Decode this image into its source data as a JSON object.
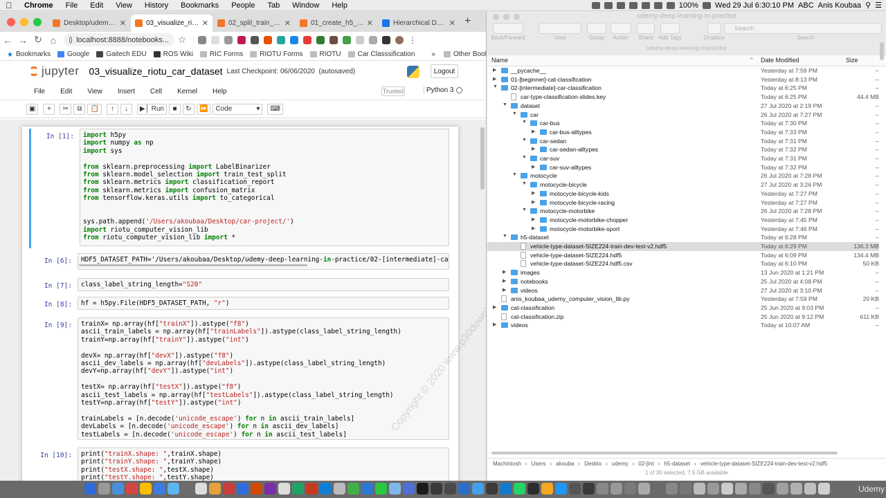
{
  "menubar": {
    "items": [
      "Chrome",
      "File",
      "Edit",
      "View",
      "History",
      "Bookmarks",
      "People",
      "Tab",
      "Window",
      "Help"
    ],
    "battery": "100%",
    "clock": "Wed 29 Jul  6:30:10 PM",
    "input_method": "ABC",
    "user": "Anis Koubaa"
  },
  "chrome": {
    "tabs": [
      {
        "label": "Desktop/udemy-de"
      },
      {
        "label": "03_visualize_riotu_c"
      },
      {
        "label": "02_split_train_dev_t"
      },
      {
        "label": "01_create_h5_datas"
      },
      {
        "label": "Hierarchical Data Fo"
      }
    ],
    "url": "localhost:8888/notebooks...",
    "bookmarks": [
      "Bookmarks",
      "Google",
      "Gaitech EDU",
      "ROS Wiki",
      "RIC Forms",
      "RIOTU Forms",
      "RIOTU",
      "Car Classsification",
      "Other Bookmarks"
    ]
  },
  "jupyter": {
    "logo": "jupyter",
    "title": "03_visualize_riotu_car_dataset",
    "checkpoint": "Last Checkpoint: 06/06/2020",
    "autosaved": "(autosaved)",
    "logout": "Logout",
    "menu": [
      "File",
      "Edit",
      "View",
      "Insert",
      "Cell",
      "Kernel",
      "Help"
    ],
    "trusted": "Trusted",
    "kernel": "Python 3",
    "toolbar": {
      "run": "Run",
      "celltype": "Code"
    },
    "cells": [
      {
        "prompt": "In [1]:",
        "code": "import h5py\nimport numpy as np\nimport sys\n\nfrom sklearn.preprocessing import LabelBinarizer\nfrom sklearn.model_selection import train_test_split\nfrom sklearn.metrics import classification_report\nfrom sklearn.metrics import confusion_matrix\nfrom tensorflow.keras.utils import to_categorical\n\n\nsys.path.append('/Users/akoubaa/Desktop/car-project/')\nimport riotu_computer_vision_lib\nfrom riotu_computer_vision_lib import *"
      },
      {
        "prompt": "In [6]:",
        "code": "HDF5_DATASET_PATH='/Users/akoubaa/Desktop/udemy-deep-learning-in-practice/02-[intermediate]-car"
      },
      {
        "prompt": "In [7]:",
        "code": "class_label_string_length=\"S20\""
      },
      {
        "prompt": "In [8]:",
        "code": "hf = h5py.File(HDF5_DATASET_PATH, \"r\")"
      },
      {
        "prompt": "In [9]:",
        "code": "trainX= np.array(hf[\"trainX\"]).astype(\"f8\")\nascii_train_labels = np.array(hf[\"trainLabels\"]).astype(class_label_string_length)\ntrainY=np.array(hf[\"trainY\"]).astype(\"int\")\n\ndevX= np.array(hf[\"devX\"]).astype(\"f8\")\nascii_dev_labels = np.array(hf[\"devLabels\"]).astype(class_label_string_length)\ndevY=np.array(hf[\"devY\"]).astype(\"int\")\n\ntestX= np.array(hf[\"testX\"]).astype(\"f8\")\nascii_test_labels = np.array(hf[\"testLabels\"]).astype(class_label_string_length)\ntestY=np.array(hf[\"testY\"]).astype(\"int\")\n\ntrainLabels = [n.decode('unicode_escape') for n in ascii_train_labels]\ndevLabels = [n.decode('unicode_escape') for n in ascii_dev_labels]\ntestLabels = [n.decode('unicode_escape') for n in ascii_test_labels]"
      },
      {
        "prompt": "In [10]:",
        "code": "print(\"trainX.shape: \",trainX.shape)\nprint(\"trainY.shape: \",trainY.shape)\nprint(\"testX.shape: \",testX.shape)\nprint(\"testY.shape: \",testY.shape)"
      }
    ]
  },
  "finder": {
    "window_title": "udemy-deep-learning-in-practice",
    "toolbar_labels": [
      "Back/Forward",
      "View",
      "Group",
      "Action",
      "Share",
      "Add Tags",
      "Dropbox"
    ],
    "search_placeholder": "Search",
    "search_label": "Search",
    "path_title": "udemy-deep-learning-in-practice",
    "columns": {
      "name": "Name",
      "date": "Date Modified",
      "size": "Size"
    },
    "rows": [
      {
        "indent": 0,
        "type": "folder",
        "open": false,
        "name": "__pycache__",
        "date": "Yesterday at 7:59 PM",
        "size": "--"
      },
      {
        "indent": 0,
        "type": "folder",
        "open": false,
        "name": "01-[beginner]-cat-classification",
        "date": "Yesterday at 8:13 PM",
        "size": "--"
      },
      {
        "indent": 0,
        "type": "folder",
        "open": true,
        "name": "02-[intermediate]-car-classification",
        "date": "Today at 6:25 PM",
        "size": "--"
      },
      {
        "indent": 1,
        "type": "file",
        "open": null,
        "name": "car-type-classification-slides.key",
        "date": "Today at 6:25 PM",
        "size": "44.4 MB"
      },
      {
        "indent": 1,
        "type": "folder",
        "open": true,
        "name": "dataset",
        "date": "27 Jul 2020 at 2:19 PM",
        "size": "--"
      },
      {
        "indent": 2,
        "type": "folder",
        "open": true,
        "name": "car",
        "date": "26 Jul 2020 at 7:27 PM",
        "size": "--"
      },
      {
        "indent": 3,
        "type": "folder",
        "open": true,
        "name": "car-bus",
        "date": "Today at 7:30 PM",
        "size": "--"
      },
      {
        "indent": 4,
        "type": "folder",
        "open": false,
        "name": "car-bus-alltypes",
        "date": "Today at 7:33 PM",
        "size": "--"
      },
      {
        "indent": 3,
        "type": "folder",
        "open": true,
        "name": "car-sedan",
        "date": "Today at 7:31 PM",
        "size": "--"
      },
      {
        "indent": 4,
        "type": "folder",
        "open": false,
        "name": "car-sedan-alltypes",
        "date": "Today at 7:32 PM",
        "size": "--"
      },
      {
        "indent": 3,
        "type": "folder",
        "open": true,
        "name": "car-suv",
        "date": "Today at 7:31 PM",
        "size": "--"
      },
      {
        "indent": 4,
        "type": "folder",
        "open": false,
        "name": "car-suv-alltypes",
        "date": "Today at 7:32 PM",
        "size": "--"
      },
      {
        "indent": 2,
        "type": "folder",
        "open": true,
        "name": "motocycle",
        "date": "26 Jul 2020 at 7:28 PM",
        "size": "--"
      },
      {
        "indent": 3,
        "type": "folder",
        "open": true,
        "name": "motocycle-bicycle",
        "date": "27 Jul 2020 at 3:26 PM",
        "size": "--"
      },
      {
        "indent": 4,
        "type": "folder",
        "open": false,
        "name": "motocycle-bicycle-kids",
        "date": "Yesterday at 7:27 PM",
        "size": "--"
      },
      {
        "indent": 4,
        "type": "folder",
        "open": false,
        "name": "motocycle-bicycle-racing",
        "date": "Yesterday at 7:27 PM",
        "size": "--"
      },
      {
        "indent": 3,
        "type": "folder",
        "open": true,
        "name": "motocycle-motorbike",
        "date": "26 Jul 2020 at 7:28 PM",
        "size": "--"
      },
      {
        "indent": 4,
        "type": "folder",
        "open": false,
        "name": "motocycle-motorbike-chopper",
        "date": "Yesterday at 7:45 PM",
        "size": "--"
      },
      {
        "indent": 4,
        "type": "folder",
        "open": false,
        "name": "motocycle-motorbike-sport",
        "date": "Yesterday at 7:46 PM",
        "size": "--"
      },
      {
        "indent": 1,
        "type": "folder",
        "open": true,
        "name": "h5-dataset",
        "date": "Today at 6:28 PM",
        "size": "--"
      },
      {
        "indent": 2,
        "type": "file",
        "open": null,
        "name": "vehicle-type-dataset-SIZE224-train-dev-test-v2.hdf5",
        "date": "Today at 6:29 PM",
        "size": "136.3 MB",
        "selected": true
      },
      {
        "indent": 2,
        "type": "file",
        "open": null,
        "name": "vehicle-type-dataset-SIZE224.hdf5",
        "date": "Today at 6:09 PM",
        "size": "134.4 MB"
      },
      {
        "indent": 2,
        "type": "file",
        "open": null,
        "name": "vehicle-type-dataset-SIZE224.hdf5.csv",
        "date": "Today at 6:10 PM",
        "size": "50 KB"
      },
      {
        "indent": 1,
        "type": "folder",
        "open": false,
        "name": "images",
        "date": "13 Jun 2020 at 1:21 PM",
        "size": "--"
      },
      {
        "indent": 1,
        "type": "folder",
        "open": false,
        "name": "notebooks",
        "date": "25 Jul 2020 at 4:08 PM",
        "size": "--"
      },
      {
        "indent": 1,
        "type": "folder",
        "open": false,
        "name": "videos",
        "date": "27 Jul 2020 at 3:10 PM",
        "size": "--"
      },
      {
        "indent": 0,
        "type": "file",
        "open": null,
        "name": "anis_koubaa_udemy_computer_vision_lib.py",
        "date": "Yesterday at 7:59 PM",
        "size": "20 KB"
      },
      {
        "indent": 0,
        "type": "folder",
        "open": false,
        "name": "cat-classification",
        "date": "25 Jun 2020 at 9:03 PM",
        "size": "--"
      },
      {
        "indent": 0,
        "type": "file",
        "open": null,
        "name": "cat-classification.zip",
        "date": "25 Jun 2020 at 9:12 PM",
        "size": "611 KB"
      },
      {
        "indent": 0,
        "type": "folder",
        "open": false,
        "name": "videos",
        "date": "Today at 10:07 AM",
        "size": "--"
      }
    ],
    "breadcrumb": [
      "Machintosh",
      "Users",
      "akouba",
      "Deskto",
      "udemy",
      "02-[int",
      "h5-dataset",
      "vehicle-type-dataset-SIZE224-train-dev-test-v2.hdf5"
    ],
    "status": "1 of 30 selected, 7.9 GB available"
  },
  "watermark": "Copyright © 2020 www.p30download.com",
  "dock": {
    "brand": "Udemy"
  }
}
